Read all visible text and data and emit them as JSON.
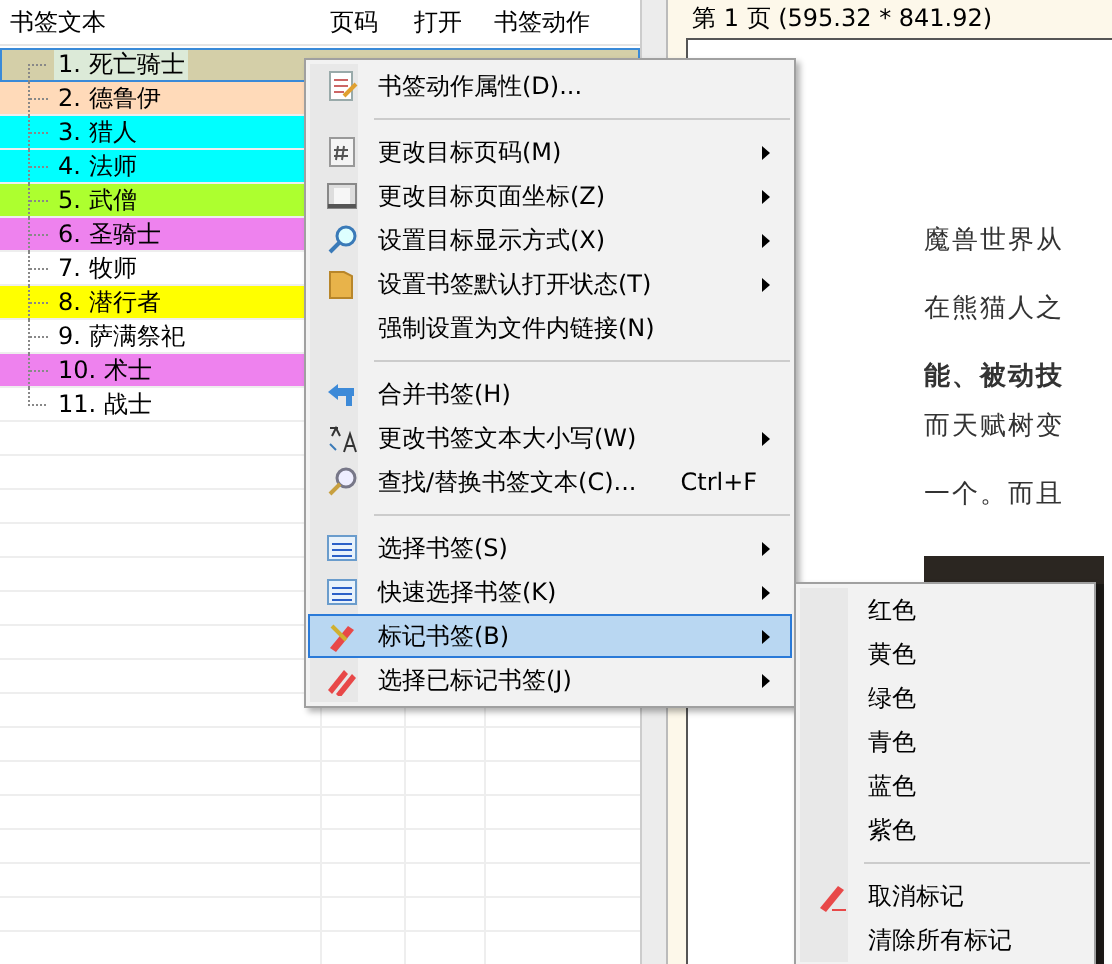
{
  "bookmark_panel": {
    "columns": [
      "书签文本",
      "页码",
      "打开",
      "书签动作"
    ],
    "rows": [
      {
        "text": "1. 死亡骑士",
        "color": "#d4cfa8",
        "selected": true
      },
      {
        "text": "2. 德鲁伊",
        "color": "#ffdab9",
        "selected": false
      },
      {
        "text": "3. 猎人",
        "color": "#00ffff",
        "selected": false
      },
      {
        "text": "4. 法师",
        "color": "#00ffff",
        "selected": false
      },
      {
        "text": "5. 武僧",
        "color": "#adff2f",
        "selected": false
      },
      {
        "text": "6. 圣骑士",
        "color": "#ee82ee",
        "selected": false
      },
      {
        "text": "7. 牧师",
        "color": "#ffffff",
        "selected": false
      },
      {
        "text": "8. 潜行者",
        "color": "#ffff00",
        "selected": false
      },
      {
        "text": "9. 萨满祭祀",
        "color": "#ffffff",
        "selected": false
      },
      {
        "text": "10. 术士",
        "color": "#ee82ee",
        "selected": false
      },
      {
        "text": "11. 战士",
        "color": "#ffffff",
        "selected": false
      }
    ]
  },
  "document": {
    "page_header": "第 1 页 (595.32 * 841.92)",
    "lines": [
      {
        "text": "魔兽世界从",
        "bold": false,
        "gap": true
      },
      {
        "text": "在熊猫人之",
        "bold": false,
        "gap": true
      },
      {
        "text": "能、被动技",
        "bold": true,
        "gap": false
      },
      {
        "text": "而天赋树变",
        "bold": false,
        "gap": true
      },
      {
        "text": "一个。而且",
        "bold": false,
        "gap": false
      }
    ]
  },
  "context_menu": {
    "items": [
      {
        "kind": "item",
        "label": "书签动作属性(D)...",
        "submenu": false,
        "selected": false
      },
      {
        "kind": "separator"
      },
      {
        "kind": "item",
        "label": "更改目标页码(M)",
        "submenu": true,
        "selected": false
      },
      {
        "kind": "item",
        "label": "更改目标页面坐标(Z)",
        "submenu": true,
        "selected": false
      },
      {
        "kind": "item",
        "label": "设置目标显示方式(X)",
        "submenu": true,
        "selected": false
      },
      {
        "kind": "item",
        "label": "设置书签默认打开状态(T)",
        "submenu": true,
        "selected": false
      },
      {
        "kind": "item",
        "label": "强制设置为文件内链接(N)",
        "submenu": false,
        "selected": false
      },
      {
        "kind": "separator"
      },
      {
        "kind": "item",
        "label": "合并书签(H)",
        "submenu": false,
        "selected": false
      },
      {
        "kind": "item",
        "label": "更改书签文本大小写(W)",
        "submenu": true,
        "selected": false
      },
      {
        "kind": "item",
        "label": "查找/替换书签文本(C)...",
        "shortcut": "Ctrl+F",
        "submenu": false,
        "selected": false
      },
      {
        "kind": "separator"
      },
      {
        "kind": "item",
        "label": "选择书签(S)",
        "submenu": true,
        "selected": false
      },
      {
        "kind": "item",
        "label": "快速选择书签(K)",
        "submenu": true,
        "selected": false
      },
      {
        "kind": "item",
        "label": "标记书签(B)",
        "submenu": true,
        "selected": true
      },
      {
        "kind": "item",
        "label": "选择已标记书签(J)",
        "submenu": true,
        "selected": false
      }
    ]
  },
  "submenu": {
    "items": [
      {
        "kind": "item",
        "label": "红色"
      },
      {
        "kind": "item",
        "label": "黄色"
      },
      {
        "kind": "item",
        "label": "绿色"
      },
      {
        "kind": "item",
        "label": "青色"
      },
      {
        "kind": "item",
        "label": "蓝色"
      },
      {
        "kind": "item",
        "label": "紫色"
      },
      {
        "kind": "separator"
      },
      {
        "kind": "item",
        "label": "取消标记"
      },
      {
        "kind": "item",
        "label": "清除所有标记"
      }
    ]
  }
}
